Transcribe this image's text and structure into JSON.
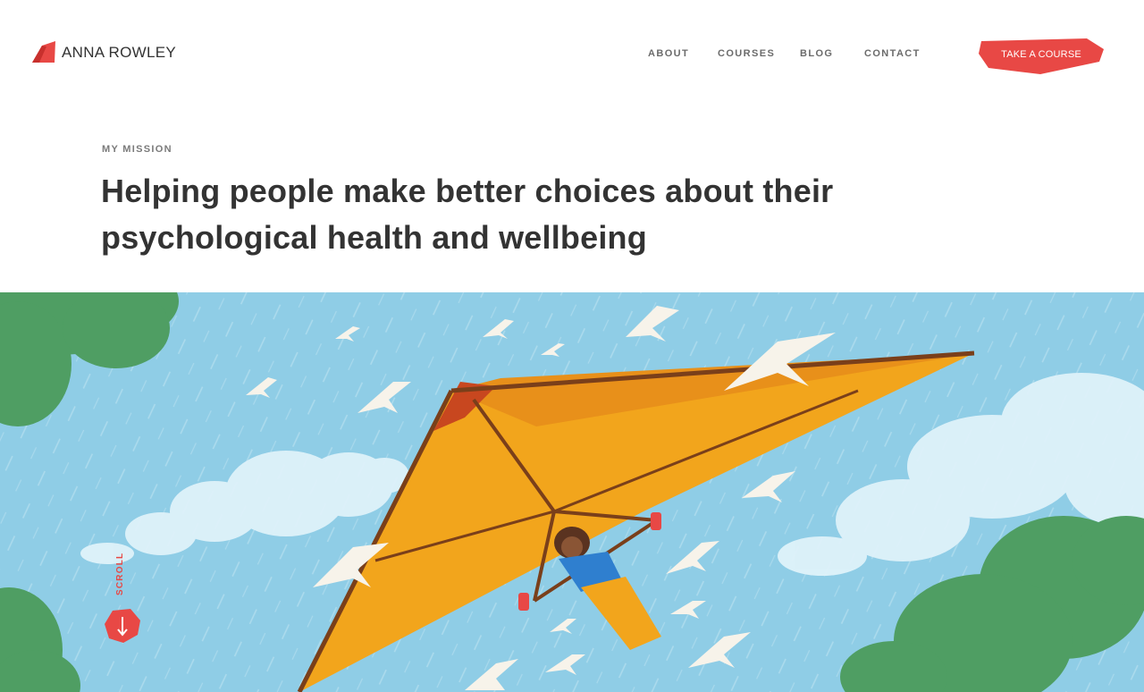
{
  "brand": {
    "name": "ANNA ROWLEY",
    "accent": "#e84845"
  },
  "nav": {
    "items": [
      "ABOUT",
      "COURSES",
      "BLOG",
      "CONTACT"
    ]
  },
  "cta": {
    "label": "TAKE A COURSE"
  },
  "hero": {
    "eyebrow": "MY MISSION",
    "headline": "Helping people make better choices about their psychological health and wellbeing",
    "scroll_label": "SCROLL"
  },
  "colors": {
    "sky": "#8fcde6",
    "glider": "#f2a51c",
    "trees": "#4f9e63",
    "text": "#333333"
  },
  "icons": {
    "logo": "logo-mark-icon",
    "scroll": "arrow-down-icon"
  }
}
